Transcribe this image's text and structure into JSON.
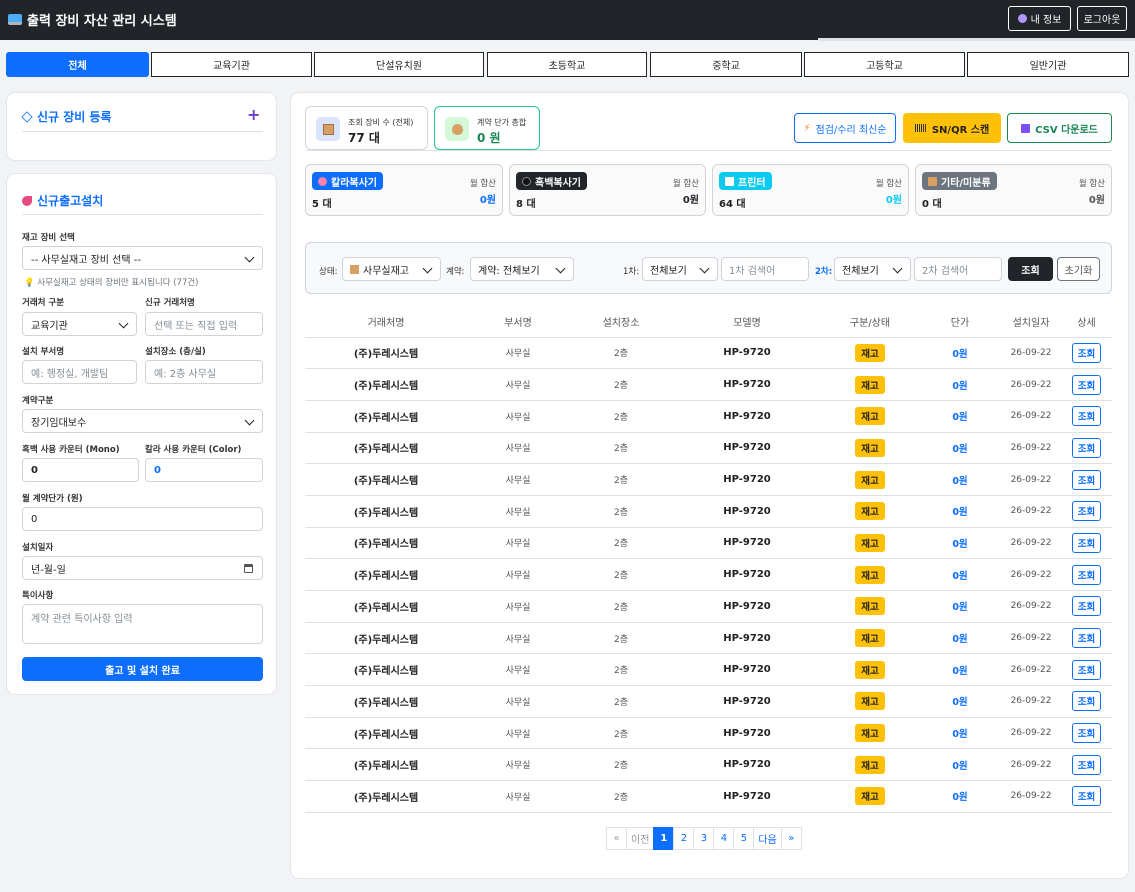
{
  "header": {
    "title": "출력 장비 자산 관리 시스템",
    "my_info": "내 정보",
    "logout": "로그아웃"
  },
  "tabs": [
    "전체",
    "교육기관",
    "단설유치원",
    "초등학교",
    "중학교",
    "고등학교",
    "일반기관"
  ],
  "new_equip": {
    "title": "신규 장비 등록",
    "plus": "+"
  },
  "install": {
    "title": "신규출고설치",
    "stock_label": "재고 장비 선택",
    "stock_value": "-- 사무실재고 장비 선택 --",
    "hint": "사무실재고 상태의 장비만 표시됩니다 (77건)",
    "client_type_label": "거래처 구분",
    "client_type_value": "교육기관",
    "new_client_label": "신규 거래처명",
    "new_client_ph": "선택 또는 직접 입력",
    "dept_label": "설치 부서명",
    "dept_ph": "예: 행정실, 개발팀",
    "place_label": "설치장소 (층/실)",
    "place_ph": "예: 2층 사무실",
    "contract_label": "계약구분",
    "contract_value": "장기임대보수",
    "mono_label": "흑백 사용 카운터 (Mono)",
    "mono_value": "0",
    "color_label": "칼라 사용 카운터 (Color)",
    "color_value": "0",
    "price_label": "월 계약단가 (원)",
    "price_value": "0",
    "date_label": "설치일자",
    "date_ph": "년-월-일",
    "note_label": "특이사항",
    "note_ph": "계약 관련 특이사항 입력",
    "submit": "출고 및 설치 완료"
  },
  "stats": {
    "count_label": "조회 장비 수 (전체)",
    "count_value": "77 대",
    "sum_label": "계약 단가 총합",
    "sum_value": "0 원"
  },
  "actions": {
    "latest": "점검/수리 최신순",
    "scan": "SN/QR 스캔",
    "csv": "CSV 다운로드"
  },
  "categories": [
    {
      "name": "칼라복사기",
      "sum_label": "월 합산",
      "count": "5 대",
      "amount": "0원",
      "color": "#0d6efd",
      "amount_color": "#0d6efd"
    },
    {
      "name": "흑백복사기",
      "sum_label": "월 합산",
      "count": "8 대",
      "amount": "0원",
      "color": "#212529",
      "amount_color": "#212529"
    },
    {
      "name": "프린터",
      "sum_label": "월 합산",
      "count": "64 대",
      "amount": "0원",
      "color": "#0dcaf0",
      "amount_color": "#0dcaf0"
    },
    {
      "name": "기타/미분류",
      "sum_label": "월 합산",
      "count": "0 대",
      "amount": "0원",
      "color": "#6c757d",
      "amount_color": "#555555"
    }
  ],
  "filters": {
    "status_label": "상태:",
    "status_value": "사무실재고",
    "contract_label": "계약:",
    "contract_value": "계약: 전체보기",
    "first_label": "1차:",
    "first_value": "전체보기",
    "first_ph": "1차 검색어",
    "second_label": "2차:",
    "second_value": "전체보기",
    "second_ph": "2차 검색어",
    "search": "조회",
    "reset": "초기화"
  },
  "table": {
    "headers": [
      "거래처명",
      "부서명",
      "설치장소",
      "모델명",
      "구분/상태",
      "단가",
      "설치일자",
      "상세"
    ],
    "rows": [
      [
        "(주)두레시스템",
        "사무실",
        "2층",
        "HP-9720",
        "재고",
        "0원",
        "26-09-22",
        "조회"
      ],
      [
        "(주)두레시스템",
        "사무실",
        "2층",
        "HP-9720",
        "재고",
        "0원",
        "26-09-22",
        "조회"
      ],
      [
        "(주)두레시스템",
        "사무실",
        "2층",
        "HP-9720",
        "재고",
        "0원",
        "26-09-22",
        "조회"
      ],
      [
        "(주)두레시스템",
        "사무실",
        "2층",
        "HP-9720",
        "재고",
        "0원",
        "26-09-22",
        "조회"
      ],
      [
        "(주)두레시스템",
        "사무실",
        "2층",
        "HP-9720",
        "재고",
        "0원",
        "26-09-22",
        "조회"
      ],
      [
        "(주)두레시스템",
        "사무실",
        "2층",
        "HP-9720",
        "재고",
        "0원",
        "26-09-22",
        "조회"
      ],
      [
        "(주)두레시스템",
        "사무실",
        "2층",
        "HP-9720",
        "재고",
        "0원",
        "26-09-22",
        "조회"
      ],
      [
        "(주)두레시스템",
        "사무실",
        "2층",
        "HP-9720",
        "재고",
        "0원",
        "26-09-22",
        "조회"
      ],
      [
        "(주)두레시스템",
        "사무실",
        "2층",
        "HP-9720",
        "재고",
        "0원",
        "26-09-22",
        "조회"
      ],
      [
        "(주)두레시스템",
        "사무실",
        "2층",
        "HP-9720",
        "재고",
        "0원",
        "26-09-22",
        "조회"
      ],
      [
        "(주)두레시스템",
        "사무실",
        "2층",
        "HP-9720",
        "재고",
        "0원",
        "26-09-22",
        "조회"
      ],
      [
        "(주)두레시스템",
        "사무실",
        "2층",
        "HP-9720",
        "재고",
        "0원",
        "26-09-22",
        "조회"
      ],
      [
        "(주)두레시스템",
        "사무실",
        "2층",
        "HP-9720",
        "재고",
        "0원",
        "26-09-22",
        "조회"
      ],
      [
        "(주)두레시스템",
        "사무실",
        "2층",
        "HP-9720",
        "재고",
        "0원",
        "26-09-22",
        "조회"
      ],
      [
        "(주)두레시스템",
        "사무실",
        "2층",
        "HP-9720",
        "재고",
        "0원",
        "26-09-22",
        "조회"
      ]
    ]
  },
  "pagination": {
    "first": "«",
    "prev": "이전",
    "pages": [
      "1",
      "2",
      "3",
      "4",
      "5"
    ],
    "current": "1",
    "next": "다음",
    "last": "»"
  }
}
